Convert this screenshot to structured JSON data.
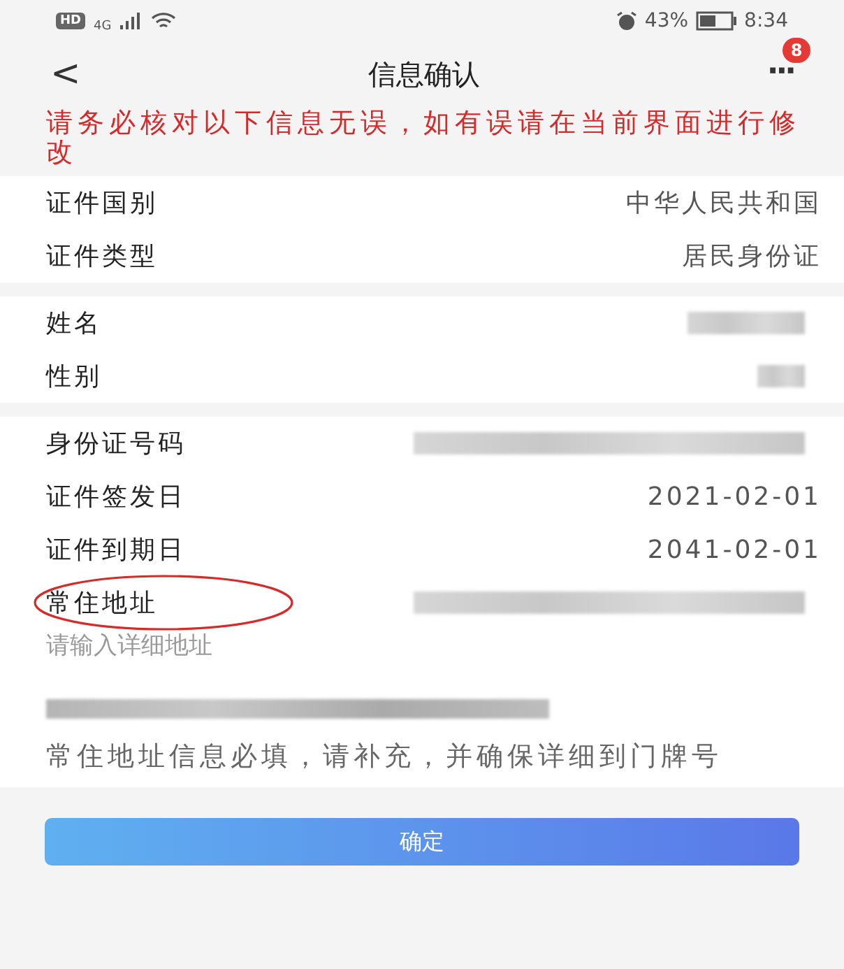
{
  "status_bar": {
    "network_badge": "HD",
    "network_type": "4G",
    "battery": "43%",
    "time": "8:34"
  },
  "header": {
    "back": "<",
    "title": "信息确认",
    "more": "···",
    "badge": "8"
  },
  "notice": "请务必核对以下信息无误，如有误请在当前界面进行修改",
  "groups": [
    {
      "rows": [
        {
          "label": "证件国别",
          "kind": "text",
          "value": "中华人民共和国"
        },
        {
          "label": "证件类型",
          "kind": "text",
          "value": "居民身份证"
        }
      ]
    },
    {
      "rows": [
        {
          "label": "姓名",
          "kind": "blurred"
        },
        {
          "label": "性别",
          "kind": "blurred"
        }
      ]
    },
    {
      "rows": [
        {
          "label": "身份证号码",
          "kind": "blurred"
        },
        {
          "label": "证件签发日",
          "kind": "text",
          "value": "2021-02-01"
        },
        {
          "label": "证件到期日",
          "kind": "text",
          "value": "2041-02-01"
        },
        {
          "label": "常住地址",
          "kind": "blurred",
          "circled": true
        }
      ]
    }
  ],
  "address": {
    "placeholder": "请输入详细地址",
    "hint": "常住地址信息必填，请补充，并确保详细到门牌号"
  },
  "confirm_button": "确定"
}
